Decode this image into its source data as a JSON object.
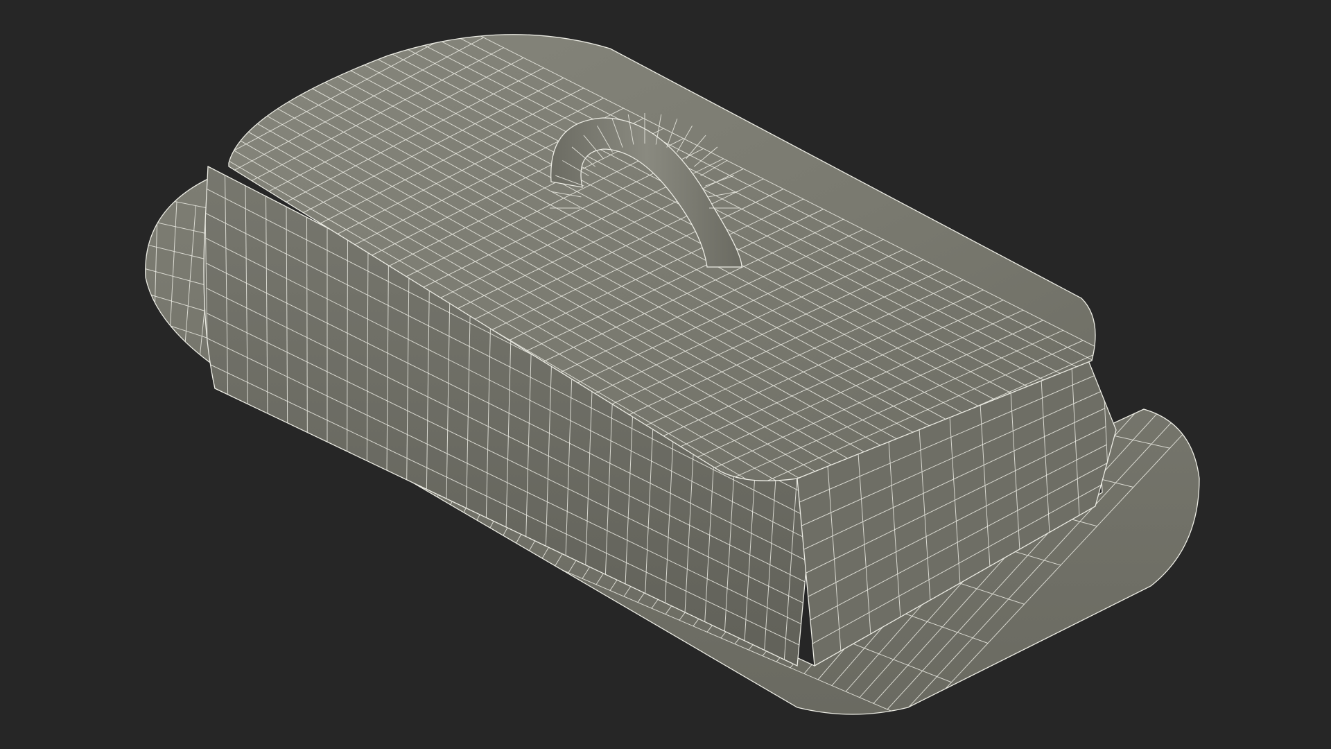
{
  "scene": {
    "subject": "butter-dish-wireframe",
    "colors": {
      "background": "#262626",
      "mesh_fill_light": "#8a8a80",
      "mesh_fill_mid": "#77776d",
      "mesh_fill_dark": "#5f5f57",
      "wire": "#ecece4"
    }
  }
}
